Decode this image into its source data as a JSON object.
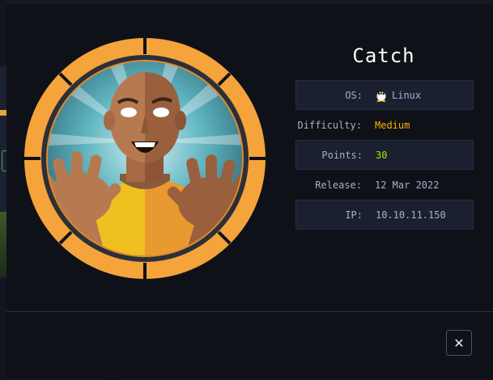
{
  "machine": {
    "name": "Catch",
    "fields": [
      {
        "label": "OS:",
        "value": "Linux",
        "icon": "linux-penguin-icon",
        "tone": "default"
      },
      {
        "label": "Difficulty:",
        "value": "Medium",
        "tone": "orange"
      },
      {
        "label": "Points:",
        "value": "30",
        "tone": "green"
      },
      {
        "label": "Release:",
        "value": "12 Mar 2022",
        "tone": "default"
      },
      {
        "label": "IP:",
        "value": "10.10.11.150",
        "tone": "default"
      }
    ]
  },
  "close_label": "✕",
  "colors": {
    "medium": "#ffaf00",
    "points": "#9fef00",
    "ring": "#f5a33b",
    "modal_bg": "#0e1117"
  }
}
